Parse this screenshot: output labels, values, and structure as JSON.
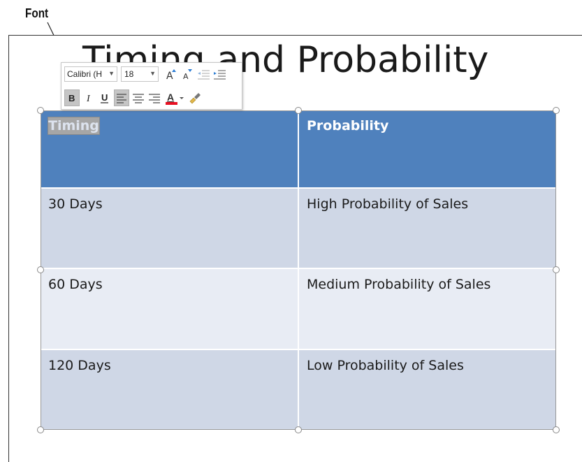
{
  "callout": {
    "label": "Font"
  },
  "slide": {
    "title": "Timing and Probability"
  },
  "table": {
    "header": [
      "Timing",
      "Probability"
    ],
    "rows": [
      [
        "30 Days",
        "High Probability of Sales"
      ],
      [
        "60 Days",
        "Medium Probability of Sales"
      ],
      [
        "120 Days",
        "Low Probability of Sales"
      ]
    ]
  },
  "mini_toolbar": {
    "font_name": "Calibri (H",
    "font_size": "18",
    "dropdown_icon": "chevron-down-icon",
    "colors": {
      "font_color_bar": "#e81123",
      "header_fill": "#4f81bd"
    }
  }
}
